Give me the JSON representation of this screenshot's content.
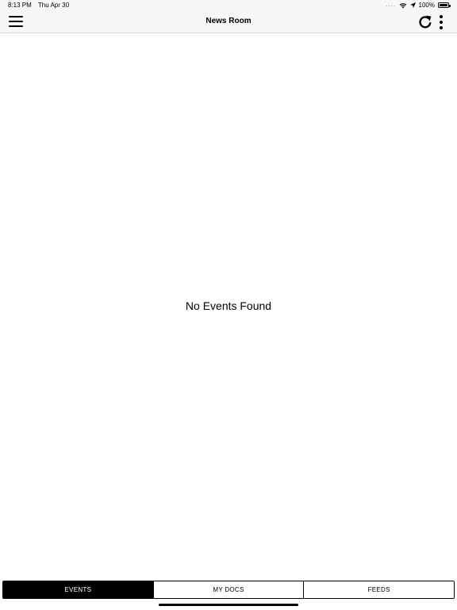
{
  "status_bar": {
    "time": "8:13 PM",
    "date": "Thu Apr 30",
    "signal": "....",
    "battery_percent": "100%",
    "battery_level": 1.0,
    "icons": [
      "wifi-icon",
      "location-arrow-icon",
      "battery-icon"
    ]
  },
  "nav": {
    "title": "News Room",
    "icons": [
      "hamburger-menu-icon",
      "refresh-icon",
      "more-vertical-icon"
    ]
  },
  "content": {
    "empty_message": "No Events Found"
  },
  "tabs": {
    "items": [
      {
        "label": "EVENTS",
        "active": true
      },
      {
        "label": "MY DOCS",
        "active": false
      },
      {
        "label": "FEEDS",
        "active": false
      }
    ]
  },
  "colors": {
    "accent": "#000000",
    "nav_background": "#f7f7f7",
    "page_background": "#ffffff"
  }
}
